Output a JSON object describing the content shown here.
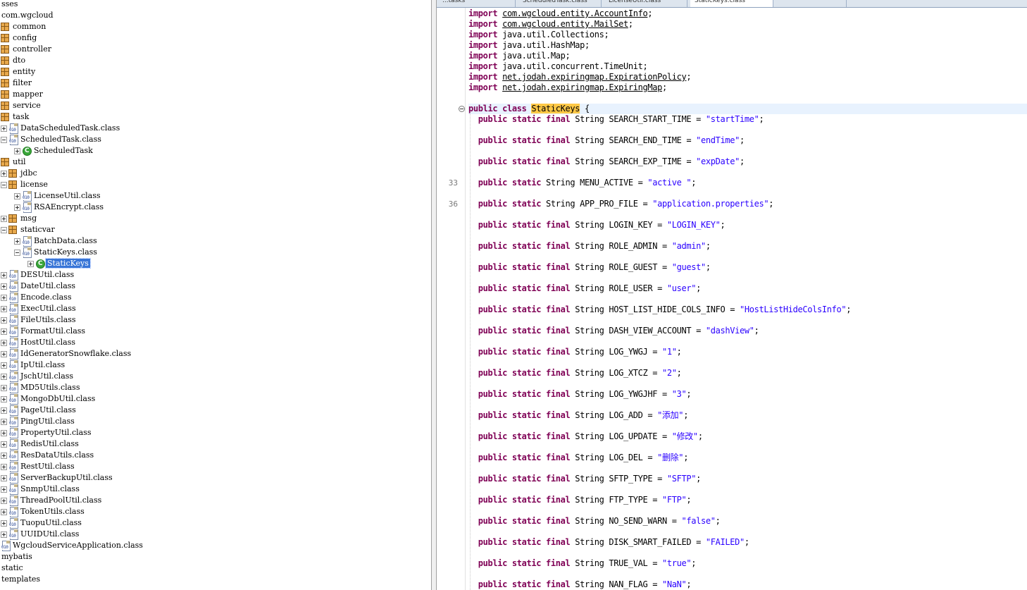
{
  "tree": {
    "rows": [
      {
        "label": "sses",
        "indent": 0,
        "toggle": "none",
        "icon": "none"
      },
      {
        "label": "com.wgcloud",
        "indent": 0,
        "toggle": "none",
        "icon": "none"
      },
      {
        "label": "common",
        "indent": 0,
        "toggle": "none",
        "icon": "package"
      },
      {
        "label": "config",
        "indent": 0,
        "toggle": "none",
        "icon": "package"
      },
      {
        "label": "controller",
        "indent": 0,
        "toggle": "none",
        "icon": "package"
      },
      {
        "label": "dto",
        "indent": 0,
        "toggle": "none",
        "icon": "package"
      },
      {
        "label": "entity",
        "indent": 0,
        "toggle": "none",
        "icon": "package"
      },
      {
        "label": "filter",
        "indent": 0,
        "toggle": "none",
        "icon": "package"
      },
      {
        "label": "mapper",
        "indent": 0,
        "toggle": "none",
        "icon": "package"
      },
      {
        "label": "service",
        "indent": 0,
        "toggle": "none",
        "icon": "package"
      },
      {
        "label": "task",
        "indent": 0,
        "toggle": "none",
        "icon": "package"
      },
      {
        "label": "DataScheduledTask.class",
        "indent": 0,
        "toggle": "plus",
        "icon": "classfile"
      },
      {
        "label": "ScheduledTask.class",
        "indent": 0,
        "toggle": "minus",
        "icon": "classfile"
      },
      {
        "label": "ScheduledTask",
        "indent": 1,
        "toggle": "plus",
        "icon": "class"
      },
      {
        "label": "util",
        "indent": 0,
        "toggle": "none",
        "icon": "package"
      },
      {
        "label": "jdbc",
        "indent": 0,
        "toggle": "plus",
        "icon": "package"
      },
      {
        "label": "license",
        "indent": 0,
        "toggle": "minus",
        "icon": "package"
      },
      {
        "label": "LicenseUtil.class",
        "indent": 1,
        "toggle": "plus",
        "icon": "classfile"
      },
      {
        "label": "RSAEncrypt.class",
        "indent": 1,
        "toggle": "plus",
        "icon": "classfile"
      },
      {
        "label": "msg",
        "indent": 0,
        "toggle": "plus",
        "icon": "package"
      },
      {
        "label": "staticvar",
        "indent": 0,
        "toggle": "minus",
        "icon": "package"
      },
      {
        "label": "BatchData.class",
        "indent": 1,
        "toggle": "plus",
        "icon": "classfile"
      },
      {
        "label": "StaticKeys.class",
        "indent": 1,
        "toggle": "minus",
        "icon": "classfile"
      },
      {
        "label": "StaticKeys",
        "indent": 2,
        "toggle": "plus",
        "icon": "class",
        "selected": true
      },
      {
        "label": "DESUtil.class",
        "indent": 0,
        "toggle": "plus",
        "icon": "classfile"
      },
      {
        "label": "DateUtil.class",
        "indent": 0,
        "toggle": "plus",
        "icon": "classfile"
      },
      {
        "label": "Encode.class",
        "indent": 0,
        "toggle": "plus",
        "icon": "classfile"
      },
      {
        "label": "ExecUtil.class",
        "indent": 0,
        "toggle": "plus",
        "icon": "classfile"
      },
      {
        "label": "FileUtils.class",
        "indent": 0,
        "toggle": "plus",
        "icon": "classfile"
      },
      {
        "label": "FormatUtil.class",
        "indent": 0,
        "toggle": "plus",
        "icon": "classfile"
      },
      {
        "label": "HostUtil.class",
        "indent": 0,
        "toggle": "plus",
        "icon": "classfile"
      },
      {
        "label": "IdGeneratorSnowflake.class",
        "indent": 0,
        "toggle": "plus",
        "icon": "classfile"
      },
      {
        "label": "IpUtil.class",
        "indent": 0,
        "toggle": "plus",
        "icon": "classfile"
      },
      {
        "label": "JschUtil.class",
        "indent": 0,
        "toggle": "plus",
        "icon": "classfile"
      },
      {
        "label": "MD5Utils.class",
        "indent": 0,
        "toggle": "plus",
        "icon": "classfile"
      },
      {
        "label": "MongoDbUtil.class",
        "indent": 0,
        "toggle": "plus",
        "icon": "classfile"
      },
      {
        "label": "PageUtil.class",
        "indent": 0,
        "toggle": "plus",
        "icon": "classfile"
      },
      {
        "label": "PingUtil.class",
        "indent": 0,
        "toggle": "plus",
        "icon": "classfile"
      },
      {
        "label": "PropertyUtil.class",
        "indent": 0,
        "toggle": "plus",
        "icon": "classfile"
      },
      {
        "label": "RedisUtil.class",
        "indent": 0,
        "toggle": "plus",
        "icon": "classfile"
      },
      {
        "label": "ResDataUtils.class",
        "indent": 0,
        "toggle": "plus",
        "icon": "classfile"
      },
      {
        "label": "RestUtil.class",
        "indent": 0,
        "toggle": "plus",
        "icon": "classfile"
      },
      {
        "label": "ServerBackupUtil.class",
        "indent": 0,
        "toggle": "plus",
        "icon": "classfile"
      },
      {
        "label": "SnmpUtil.class",
        "indent": 0,
        "toggle": "plus",
        "icon": "classfile"
      },
      {
        "label": "ThreadPoolUtil.class",
        "indent": 0,
        "toggle": "plus",
        "icon": "classfile"
      },
      {
        "label": "TokenUtils.class",
        "indent": 0,
        "toggle": "plus",
        "icon": "classfile"
      },
      {
        "label": "TuopuUtil.class",
        "indent": 0,
        "toggle": "plus",
        "icon": "classfile"
      },
      {
        "label": "UUIDUtil.class",
        "indent": 0,
        "toggle": "plus",
        "icon": "classfile"
      },
      {
        "label": "WgcloudServiceApplication.class",
        "indent": 0,
        "toggle": "none",
        "icon": "classfile"
      },
      {
        "label": "mybatis",
        "indent": 0,
        "toggle": "none",
        "icon": "none"
      },
      {
        "label": "static",
        "indent": 0,
        "toggle": "none",
        "icon": "none"
      },
      {
        "label": "templates",
        "indent": 0,
        "toggle": "none",
        "icon": "none"
      }
    ]
  },
  "editor": {
    "tabs": [
      {
        "label": "...tasks",
        "active": false
      },
      {
        "label": "ScheduledTask.class",
        "active": false
      },
      {
        "label": "LicenseUtil.class",
        "active": false
      },
      {
        "label": "StaticKeys.class",
        "active": true
      },
      {
        "label": "",
        "active": false
      }
    ],
    "code_lines": [
      {
        "text": "import com.wgcloud.entity.AccountInfo;",
        "kind": "import"
      },
      {
        "text": "import com.wgcloud.entity.MailSet;",
        "kind": "import"
      },
      {
        "text": "import java.util.Collections;",
        "kind": "import_plain"
      },
      {
        "text": "import java.util.HashMap;",
        "kind": "import_plain"
      },
      {
        "text": "import java.util.Map;",
        "kind": "import_plain"
      },
      {
        "text": "import java.util.concurrent.TimeUnit;",
        "kind": "import_plain"
      },
      {
        "text": "import net.jodah.expiringmap.ExpirationPolicy;",
        "kind": "import"
      },
      {
        "text": "import net.jodah.expiringmap.ExpiringMap;",
        "kind": "import"
      },
      {
        "text": "",
        "kind": "blank"
      },
      {
        "text": "public class StaticKeys {",
        "kind": "class_decl",
        "name": "StaticKeys",
        "current": true,
        "fold": true
      },
      {
        "text": "  public static final String SEARCH_START_TIME = \"startTime\";",
        "kind": "field"
      },
      {
        "text": "",
        "kind": "blank"
      },
      {
        "text": "  public static final String SEARCH_END_TIME = \"endTime\";",
        "kind": "field"
      },
      {
        "text": "",
        "kind": "blank"
      },
      {
        "text": "  public static final String SEARCH_EXP_TIME = \"expDate\";",
        "kind": "field"
      },
      {
        "text": "",
        "kind": "blank"
      },
      {
        "text": "  public static String MENU_ACTIVE = \"active \";",
        "kind": "field",
        "line_no": "33"
      },
      {
        "text": "",
        "kind": "blank"
      },
      {
        "text": "  public static String APP_PRO_FILE = \"application.properties\";",
        "kind": "field",
        "line_no": "36"
      },
      {
        "text": "",
        "kind": "blank"
      },
      {
        "text": "  public static final String LOGIN_KEY = \"LOGIN_KEY\";",
        "kind": "field"
      },
      {
        "text": "",
        "kind": "blank"
      },
      {
        "text": "  public static final String ROLE_ADMIN = \"admin\";",
        "kind": "field"
      },
      {
        "text": "",
        "kind": "blank"
      },
      {
        "text": "  public static final String ROLE_GUEST = \"guest\";",
        "kind": "field"
      },
      {
        "text": "",
        "kind": "blank"
      },
      {
        "text": "  public static final String ROLE_USER = \"user\";",
        "kind": "field"
      },
      {
        "text": "",
        "kind": "blank"
      },
      {
        "text": "  public static final String HOST_LIST_HIDE_COLS_INFO = \"HostListHideColsInfo\";",
        "kind": "field"
      },
      {
        "text": "",
        "kind": "blank"
      },
      {
        "text": "  public static final String DASH_VIEW_ACCOUNT = \"dashView\";",
        "kind": "field"
      },
      {
        "text": "",
        "kind": "blank"
      },
      {
        "text": "  public static final String LOG_YWGJ = \"1\";",
        "kind": "field"
      },
      {
        "text": "",
        "kind": "blank"
      },
      {
        "text": "  public static final String LOG_XTCZ = \"2\";",
        "kind": "field"
      },
      {
        "text": "",
        "kind": "blank"
      },
      {
        "text": "  public static final String LOG_YWGJHF = \"3\";",
        "kind": "field"
      },
      {
        "text": "",
        "kind": "blank"
      },
      {
        "text": "  public static final String LOG_ADD = \"添加\";",
        "kind": "field"
      },
      {
        "text": "",
        "kind": "blank"
      },
      {
        "text": "  public static final String LOG_UPDATE = \"修改\";",
        "kind": "field"
      },
      {
        "text": "",
        "kind": "blank"
      },
      {
        "text": "  public static final String LOG_DEL = \"删除\";",
        "kind": "field"
      },
      {
        "text": "",
        "kind": "blank"
      },
      {
        "text": "  public static final String SFTP_TYPE = \"SFTP\";",
        "kind": "field"
      },
      {
        "text": "",
        "kind": "blank"
      },
      {
        "text": "  public static final String FTP_TYPE = \"FTP\";",
        "kind": "field"
      },
      {
        "text": "",
        "kind": "blank"
      },
      {
        "text": "  public static final String NO_SEND_WARN = \"false\";",
        "kind": "field"
      },
      {
        "text": "",
        "kind": "blank"
      },
      {
        "text": "  public static final String DISK_SMART_FAILED = \"FAILED\";",
        "kind": "field"
      },
      {
        "text": "",
        "kind": "blank"
      },
      {
        "text": "  public static final String TRUE_VAL = \"true\";",
        "kind": "field"
      },
      {
        "text": "",
        "kind": "blank"
      },
      {
        "text": "  public static final String NAN_FLAG = \"NaN\";",
        "kind": "field"
      }
    ]
  },
  "colors": {
    "keyword": "#7f0055",
    "string": "#2a00ff",
    "selection": "#3875d7",
    "highlight": "#ffc846",
    "current_line": "#e8f2fe"
  }
}
